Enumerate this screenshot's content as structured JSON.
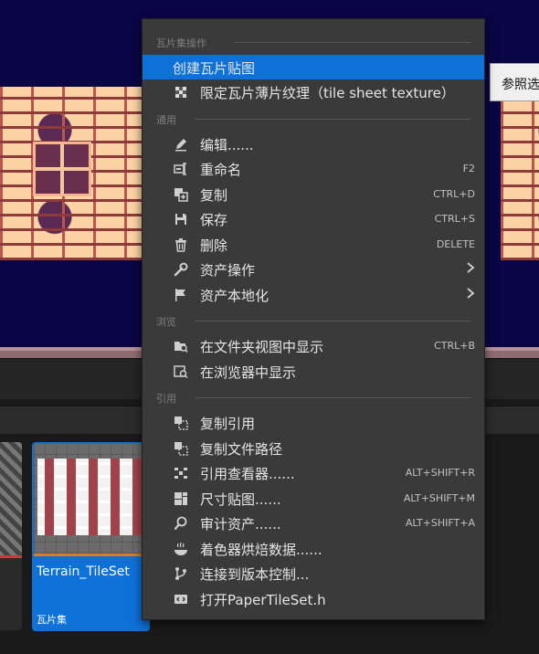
{
  "tooltip": {
    "text": "参照选"
  },
  "asset": {
    "name": "Terrain_TileSet",
    "type": "瓦片集"
  },
  "menu": {
    "sections": {
      "tileset_ops": "瓦片集操作",
      "common": "通用",
      "browse": "浏览",
      "references": "引用"
    },
    "items": {
      "create_tilemap": {
        "label": "创建瓦片贴图",
        "icon": "tilemap-icon"
      },
      "limit_tile_sheet": {
        "label": "限定瓦片薄片纹理（tile sheet texture）",
        "icon": "checker-icon"
      },
      "edit": {
        "label": "编辑......",
        "icon": "pencil-icon"
      },
      "rename": {
        "label": "重命名",
        "shortcut": "F2",
        "icon": "rename-icon"
      },
      "duplicate": {
        "label": "复制",
        "shortcut": "CTRL+D",
        "icon": "duplicate-icon"
      },
      "save": {
        "label": "保存",
        "shortcut": "CTRL+S",
        "icon": "save-icon"
      },
      "delete": {
        "label": "删除",
        "shortcut": "DELETE",
        "icon": "trash-icon"
      },
      "asset_actions": {
        "label": "资产操作",
        "icon": "wrench-icon"
      },
      "asset_localization": {
        "label": "资产本地化",
        "icon": "flag-icon"
      },
      "show_in_folder": {
        "label": "在文件夹视图中显示",
        "shortcut": "CTRL+B",
        "icon": "folder-search-icon"
      },
      "show_in_browser": {
        "label": "在浏览器中显示",
        "icon": "browser-search-icon"
      },
      "copy_reference": {
        "label": "复制引用",
        "icon": "copy-reference-icon"
      },
      "copy_file_path": {
        "label": "复制文件路径",
        "icon": "copy-path-icon"
      },
      "reference_viewer": {
        "label": "引用查看器......",
        "shortcut": "ALT+SHIFT+R",
        "icon": "reference-viewer-icon"
      },
      "size_map": {
        "label": "尺寸贴图......",
        "shortcut": "ALT+SHIFT+M",
        "icon": "size-map-icon"
      },
      "audit_assets": {
        "label": "审计资产......",
        "shortcut": "ALT+SHIFT+A",
        "icon": "audit-icon"
      },
      "shader_cook": {
        "label": "着色器烘焙数据......",
        "icon": "shader-cook-icon"
      },
      "source_control": {
        "label": "连接到版本控制...",
        "icon": "source-control-icon"
      },
      "open_header": {
        "label": "打开PaperTileSet.h",
        "icon": "cpp-header-icon"
      }
    },
    "highlight_color": "#0e71d8"
  }
}
